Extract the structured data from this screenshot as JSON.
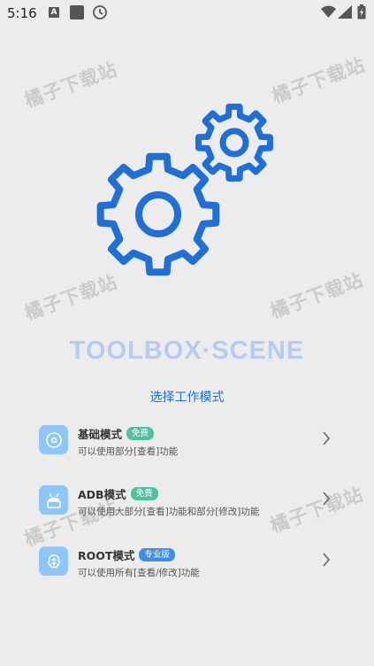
{
  "status": {
    "time": "5:16",
    "a_badge": "A"
  },
  "watermark_text": "橘子下载站",
  "app": {
    "title": "TOOLBOX·SCENE",
    "subtitle": "选择工作模式",
    "accent": "#1f6fd6"
  },
  "modes": [
    {
      "title": "基础模式",
      "badge": "免费",
      "desc": "可以使用部分[查看]功能",
      "icon": "disc-icon"
    },
    {
      "title": "ADB模式",
      "badge": "免费",
      "desc": "可以使用大部分[查看]功能和部分[修改]功能",
      "icon": "android-icon"
    },
    {
      "title": "ROOT模式",
      "badge": "专业版",
      "desc": "可以使用所有[查看/修改]功能",
      "icon": "brain-chip-icon"
    }
  ]
}
